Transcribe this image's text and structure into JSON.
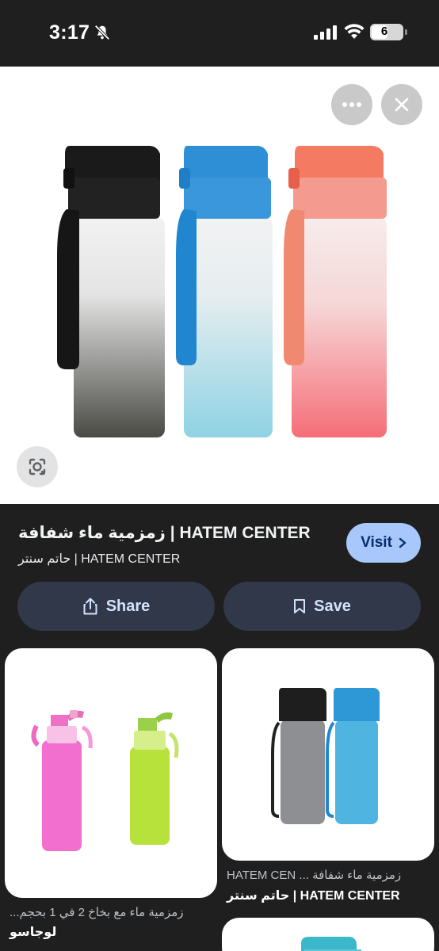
{
  "status_bar": {
    "time": "3:17",
    "battery": "6"
  },
  "hero": {
    "more_icon": "more-horiz-icon",
    "close_icon": "close-icon",
    "lens_icon": "google-lens-icon"
  },
  "result": {
    "title": "زمزمية ماء شفافة | HATEM CENTER",
    "source": "حاتم سنتر | HATEM CENTER",
    "visit_label": "Visit",
    "share_label": "Share",
    "save_label": "Save"
  },
  "related": [
    {
      "title": "زمزمية ماء مع بخاخ 2 في 1 بحجم...",
      "source": "لوجاسو"
    },
    {
      "title": "زمزمية ماء شفافة ... HATEM CEN",
      "source": "حاتم سنتر | HATEM CENTER"
    }
  ],
  "colors": {
    "accent": "#a8c7fa",
    "button_bg": "#303849",
    "page_bg": "#1f1f1f"
  }
}
